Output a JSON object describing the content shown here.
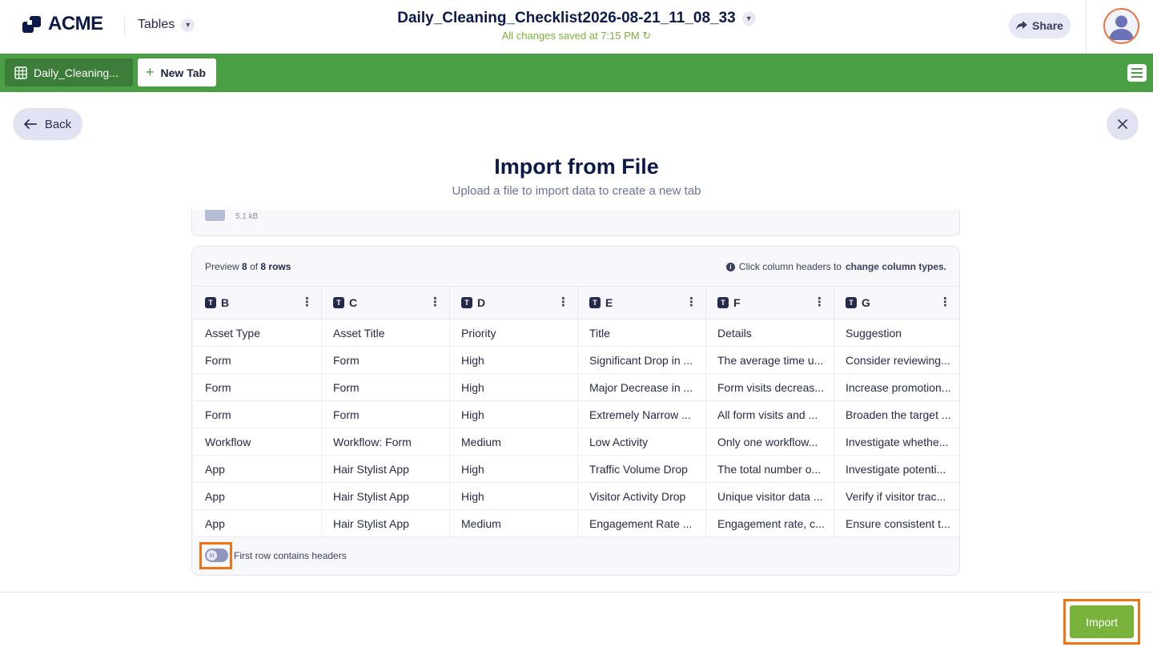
{
  "header": {
    "brand": "ACME",
    "app_menu_label": "Tables",
    "doc_title": "Daily_Cleaning_Checklist2026-08-21_11_08_33",
    "save_status": "All changes saved at 7:15 PM",
    "share_label": "Share"
  },
  "tabs": {
    "active_label": "Daily_Cleaning...",
    "new_tab_label": "New Tab"
  },
  "nav": {
    "back_label": "Back"
  },
  "dialog": {
    "title": "Import from File",
    "subtitle": "Upload a file to import data to create a new tab",
    "file_size": "5.1 kB"
  },
  "preview": {
    "prefix": "Preview",
    "shown": "8",
    "of": "of",
    "total": "8 rows",
    "hint_prefix": "Click column headers to",
    "hint_bold": "change column types.",
    "columns": [
      {
        "type": "T",
        "name": "B"
      },
      {
        "type": "T",
        "name": "C"
      },
      {
        "type": "T",
        "name": "D"
      },
      {
        "type": "T",
        "name": "E"
      },
      {
        "type": "T",
        "name": "F"
      },
      {
        "type": "T",
        "name": "G"
      }
    ],
    "rows": [
      [
        "Asset Type",
        "Asset Title",
        "Priority",
        "Title",
        "Details",
        "Suggestion"
      ],
      [
        "Form",
        "Form",
        "High",
        "Significant Drop in ...",
        "The average time u...",
        "Consider reviewing..."
      ],
      [
        "Form",
        "Form",
        "High",
        "Major Decrease in ...",
        "Form visits decreas...",
        "Increase promotion..."
      ],
      [
        "Form",
        "Form",
        "High",
        "Extremely Narrow ...",
        "All form visits and ...",
        "Broaden the target ..."
      ],
      [
        "Workflow",
        "Workflow: Form",
        "Medium",
        "Low Activity",
        "Only one workflow...",
        "Investigate whethe..."
      ],
      [
        "App",
        "Hair Stylist App",
        "High",
        "Traffic Volume Drop",
        "The total number o...",
        "Investigate potenti..."
      ],
      [
        "App",
        "Hair Stylist App",
        "High",
        "Visitor Activity Drop",
        "Unique visitor data ...",
        "Verify if visitor trac..."
      ],
      [
        "App",
        "Hair Stylist App",
        "Medium",
        "Engagement Rate ...",
        "Engagement rate, c...",
        "Ensure consistent t..."
      ]
    ],
    "first_row_headers_label": "First row contains headers",
    "first_row_headers_on": false
  },
  "footer": {
    "import_label": "Import"
  },
  "colors": {
    "brand_navy": "#0b1a4a",
    "tabbar_green": "#4a9f45",
    "import_green": "#7ab33c",
    "highlight_orange": "#f07414"
  }
}
